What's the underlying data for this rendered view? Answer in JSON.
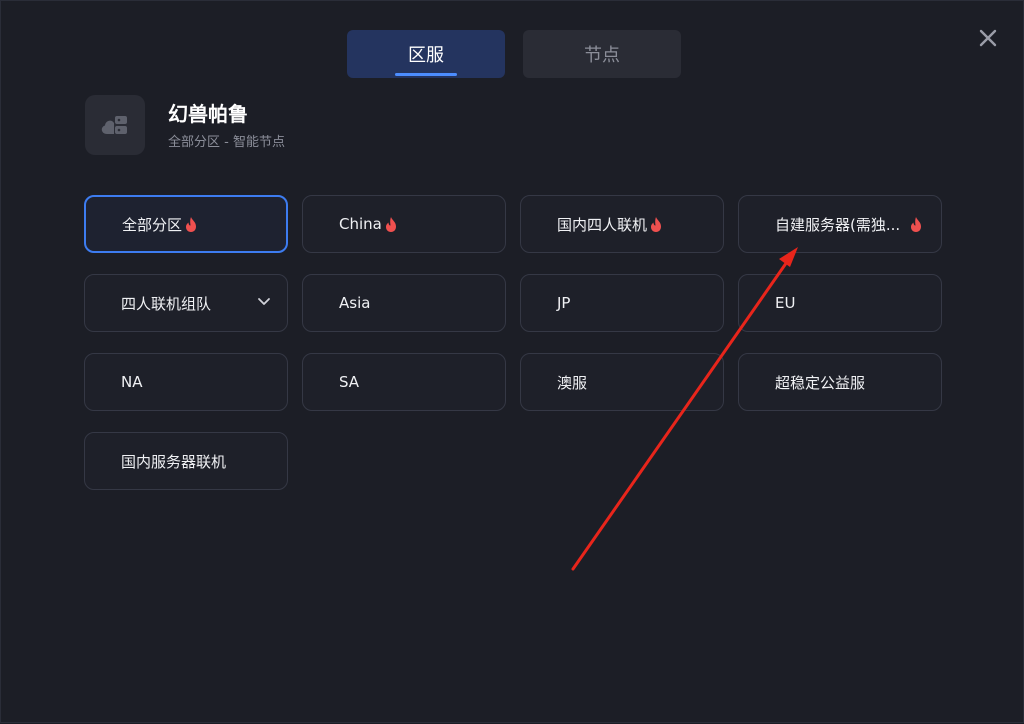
{
  "tabs": [
    {
      "label": "区服",
      "active": true
    },
    {
      "label": "节点",
      "active": false
    }
  ],
  "game": {
    "title": "幻兽帕鲁",
    "subtitle": "全部分区 - 智能节点",
    "icon": "server-cloud-icon"
  },
  "options": [
    {
      "label": "全部分区",
      "hot": true,
      "selected": true
    },
    {
      "label": "China",
      "hot": true
    },
    {
      "label": "国内四人联机",
      "hot": true
    },
    {
      "label": "自建服务器(需独...",
      "hot": true
    },
    {
      "label": "四人联机组队",
      "dropdown": true
    },
    {
      "label": "Asia"
    },
    {
      "label": "JP"
    },
    {
      "label": "EU"
    },
    {
      "label": "NA"
    },
    {
      "label": "SA"
    },
    {
      "label": "澳服"
    },
    {
      "label": "超稳定公益服"
    },
    {
      "label": "国内服务器联机"
    }
  ],
  "colors": {
    "accent": "#3d7cf0",
    "hot": "#f0504f",
    "arrow": "#e8251b"
  }
}
